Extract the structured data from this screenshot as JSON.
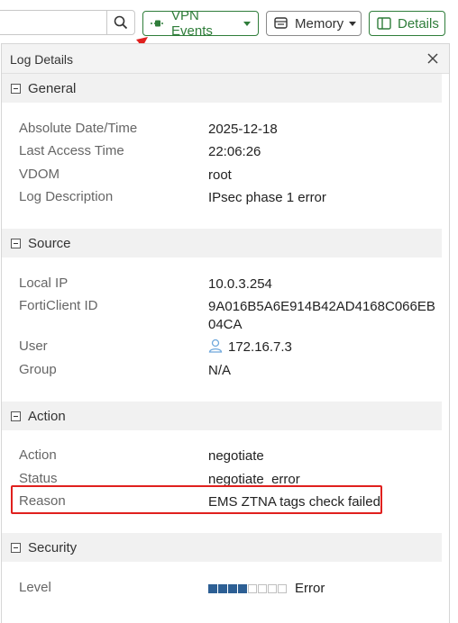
{
  "toolbar": {
    "search_value": "",
    "vpn_events_label": "VPN Events",
    "memory_label": "Memory",
    "details_label": "Details"
  },
  "panel": {
    "title": "Log Details"
  },
  "sections": {
    "general": {
      "title": "General",
      "rows": [
        {
          "label": "Absolute Date/Time",
          "value": "2025-12-18"
        },
        {
          "label": "Last Access Time",
          "value": "22:06:26"
        },
        {
          "label": "VDOM",
          "value": "root"
        },
        {
          "label": "Log Description",
          "value": "IPsec phase 1 error"
        }
      ]
    },
    "source": {
      "title": "Source",
      "rows": [
        {
          "label": "Local IP",
          "value": "10.0.3.254"
        },
        {
          "label": "FortiClient ID",
          "value": "9A016B5A6E914B42AD4168C066EB04CA"
        },
        {
          "label": "User",
          "value": "172.16.7.3"
        },
        {
          "label": "Group",
          "value": "N/A"
        }
      ]
    },
    "action": {
      "title": "Action",
      "rows": [
        {
          "label": "Action",
          "value": "negotiate"
        },
        {
          "label": "Status",
          "value": "negotiate_error"
        },
        {
          "label": "Reason",
          "value": "EMS ZTNA tags check failed"
        }
      ]
    },
    "security": {
      "title": "Security",
      "rows": [
        {
          "label": "Level",
          "value": "Error",
          "level_filled": 4,
          "level_total": 8
        }
      ]
    }
  },
  "colors": {
    "accent_green": "#2f7d3a",
    "level_blue": "#2d5f94",
    "highlight_red": "#e0201e"
  }
}
